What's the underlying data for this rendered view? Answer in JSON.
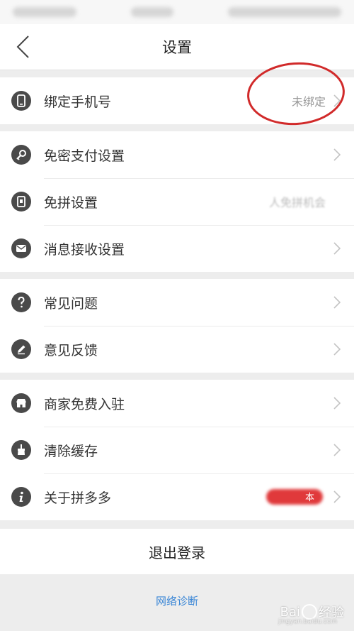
{
  "header": {
    "title": "设置"
  },
  "groups": [
    {
      "items": [
        {
          "label": "绑定手机号",
          "value": "未绑定",
          "icon": "phone-icon"
        }
      ]
    },
    {
      "items": [
        {
          "label": "免密支付设置",
          "icon": "key-icon"
        },
        {
          "label": "免拼设置",
          "value": "人免拼机会",
          "icon": "card-icon"
        },
        {
          "label": "消息接收设置",
          "icon": "mail-icon"
        }
      ]
    },
    {
      "items": [
        {
          "label": "常见问题",
          "icon": "question-icon"
        },
        {
          "label": "意见反馈",
          "icon": "pencil-icon"
        }
      ]
    },
    {
      "items": [
        {
          "label": "商家免费入驻",
          "icon": "store-icon"
        },
        {
          "label": "清除缓存",
          "icon": "brush-icon"
        },
        {
          "label": "关于拼多多",
          "value": "本",
          "icon": "info-icon"
        }
      ]
    }
  ],
  "logout": {
    "label": "退出登录"
  },
  "footer": {
    "network_diagnose": "网络诊断"
  },
  "watermark": {
    "text": "Bai",
    "text2": "经验",
    "sub": "jingyan.baidu.com"
  },
  "colors": {
    "accent_link": "#3a86d6",
    "annotation": "#d12a2a",
    "badge": "#e0393b"
  }
}
